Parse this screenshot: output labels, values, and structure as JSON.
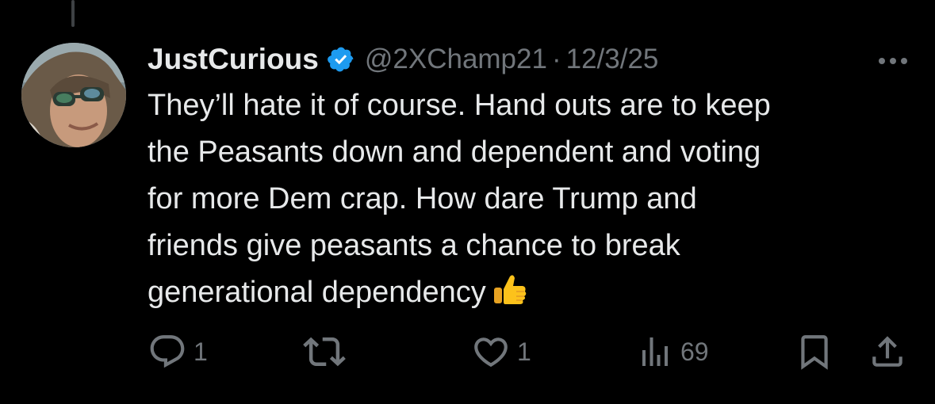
{
  "tweet": {
    "display_name": "JustCurious",
    "handle": "@2XChamp21",
    "separator": "·",
    "date": "12/3/25",
    "text": "They’ll hate it of course. Hand outs are to keep\nthe Peasants down and dependent and voting\nfor more Dem crap. How dare Trump and\nfriends give peasants a chance to break\ngenerational dependency",
    "emoji": "thumbs-up",
    "verified": true
  },
  "actions": {
    "reply_count": "1",
    "retweet_count": "",
    "like_count": "1",
    "view_count": "69"
  },
  "icons": [
    "more-icon",
    "verified-icon",
    "reply-icon",
    "retweet-icon",
    "like-icon",
    "views-icon",
    "bookmark-icon",
    "share-icon"
  ],
  "colors": {
    "background": "#000000",
    "primary_text": "#e7e9ea",
    "secondary_text": "#71767b",
    "verified_blue": "#1d9bf0",
    "thread_line": "#3e4144"
  }
}
